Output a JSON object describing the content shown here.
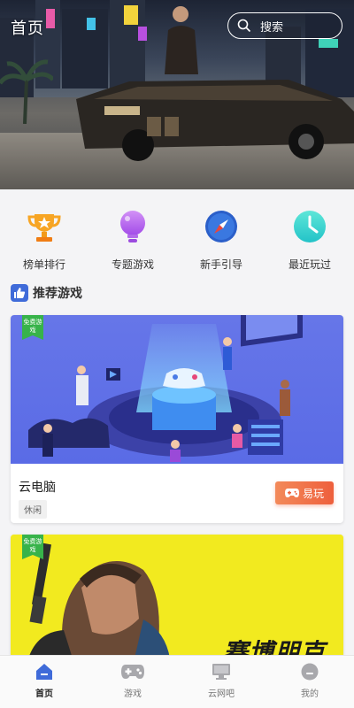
{
  "header": {
    "title": "首页",
    "search_placeholder": "搜索"
  },
  "quick_links": [
    {
      "label": "榜单排行",
      "icon": "trophy-icon"
    },
    {
      "label": "专题游戏",
      "icon": "lightbulb-icon"
    },
    {
      "label": "新手引导",
      "icon": "compass-icon"
    },
    {
      "label": "最近玩过",
      "icon": "clock-icon"
    }
  ],
  "section": {
    "title": "推荐游戏",
    "icon": "thumbs-up-icon"
  },
  "games": [
    {
      "badge": "免费游戏",
      "name": "云电脑",
      "tag": "休闲",
      "play_label": "易玩"
    },
    {
      "badge": "免费游戏",
      "logo_text": "赛博朋克"
    }
  ],
  "nav": [
    {
      "label": "首页",
      "icon": "home-icon",
      "active": true
    },
    {
      "label": "游戏",
      "icon": "gamepad-icon",
      "active": false
    },
    {
      "label": "云网吧",
      "icon": "computer-icon",
      "active": false
    },
    {
      "label": "我的",
      "icon": "profile-icon",
      "active": false
    }
  ],
  "colors": {
    "accent": "#3f6bd9",
    "play_button": "#ee5f3c",
    "badge": "#37b34a",
    "card1_bg": "#5a6be6",
    "card2_bg": "#f2ea1f"
  }
}
